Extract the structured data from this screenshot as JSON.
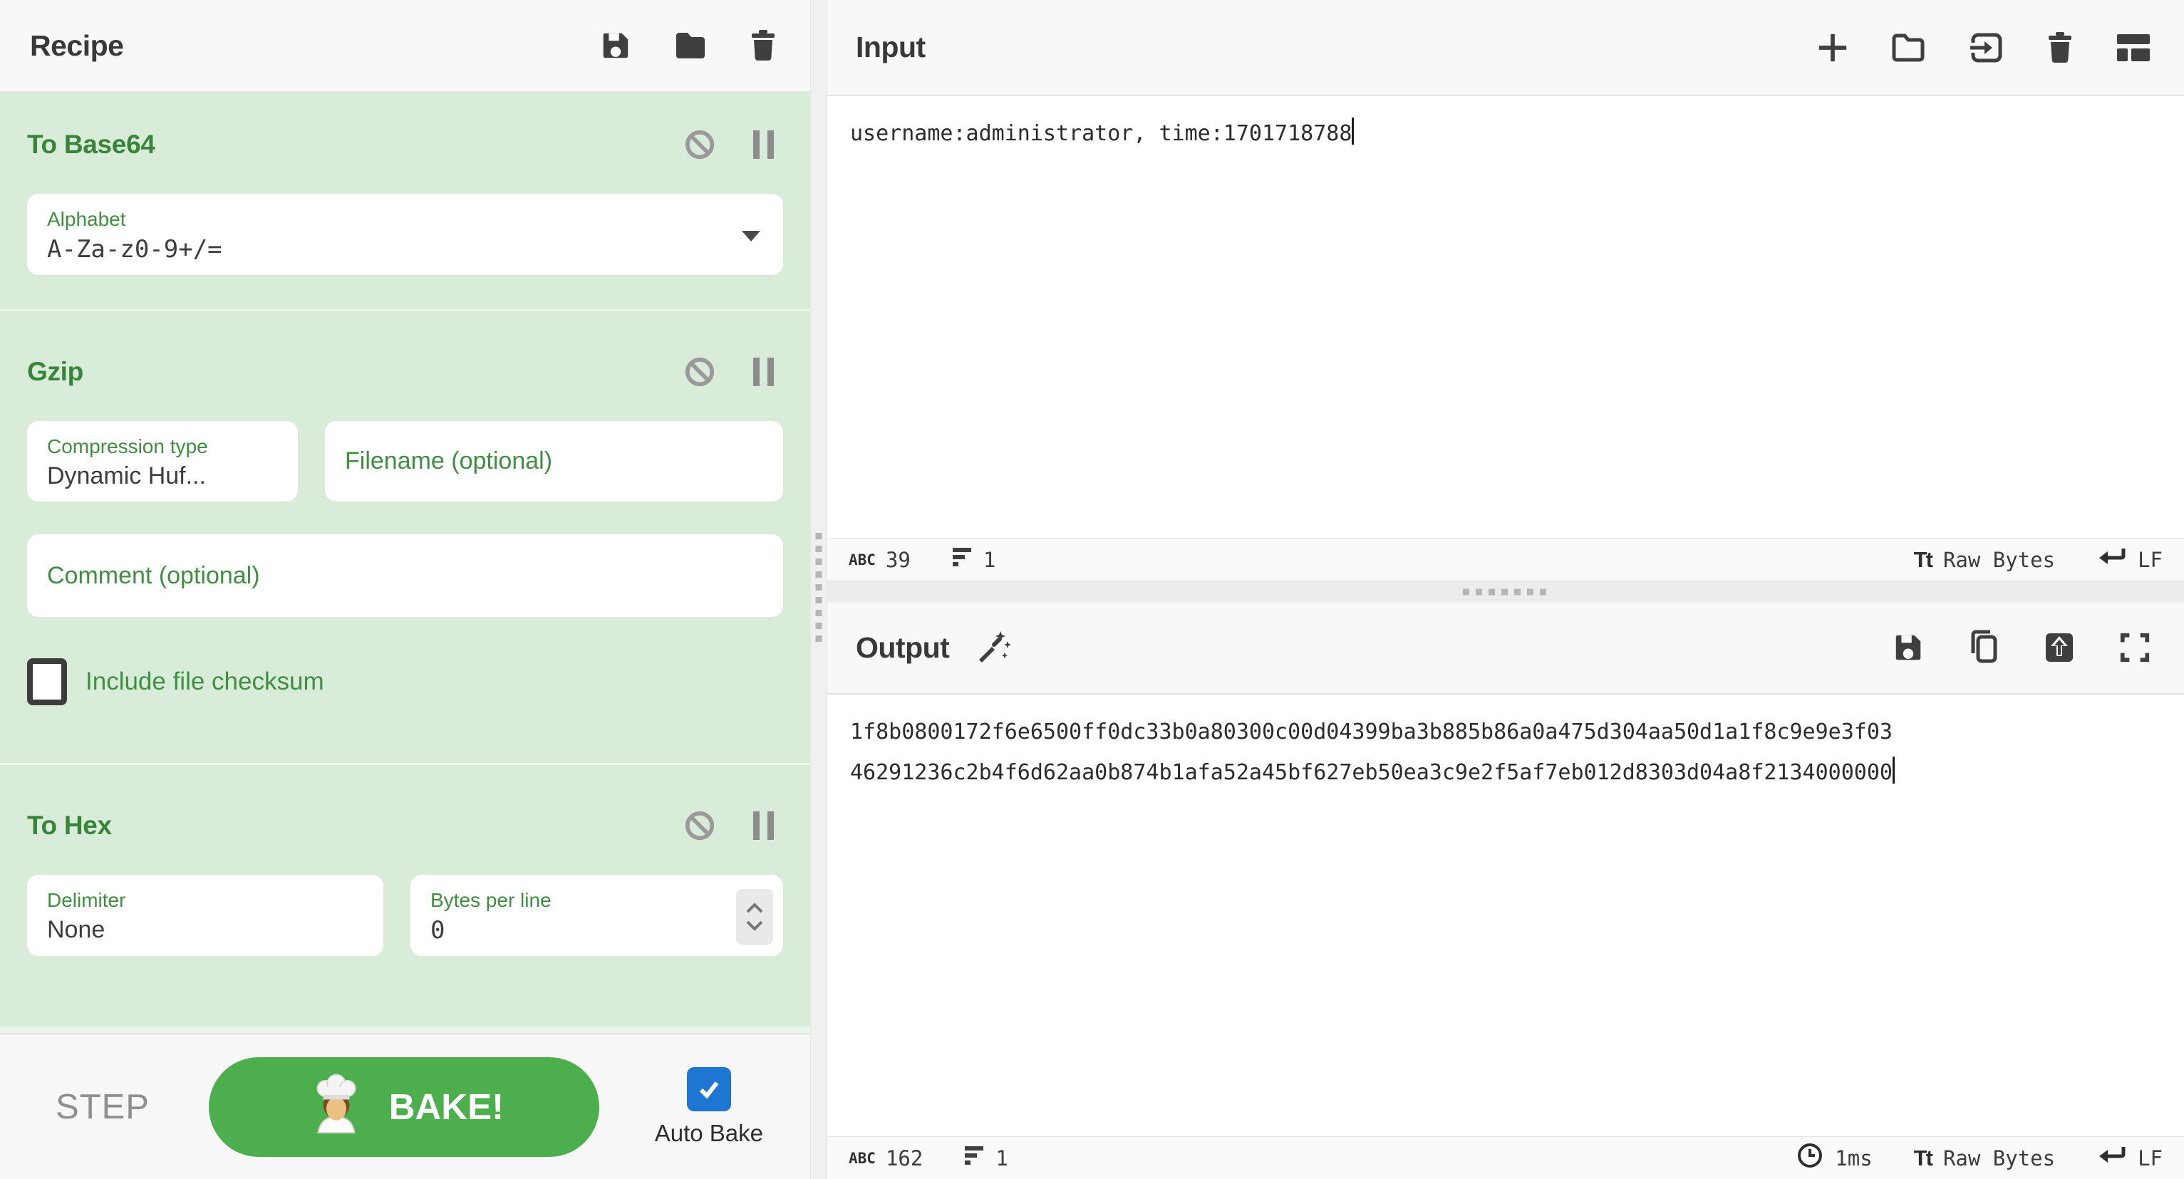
{
  "recipe": {
    "title": "Recipe",
    "operations": [
      {
        "name": "To Base64",
        "args": {
          "alphabet_label": "Alphabet",
          "alphabet_value": "A-Za-z0-9+/="
        }
      },
      {
        "name": "Gzip",
        "args": {
          "compression_label": "Compression type",
          "compression_value": "Dynamic Huf...",
          "filename_placeholder": "Filename (optional)",
          "comment_placeholder": "Comment (optional)",
          "checksum_label": "Include file checksum",
          "checksum_checked": false
        }
      },
      {
        "name": "To Hex",
        "args": {
          "delimiter_label": "Delimiter",
          "delimiter_value": "None",
          "bytes_label": "Bytes per line",
          "bytes_value": "0"
        }
      }
    ],
    "controls": {
      "step_label": "STEP",
      "bake_label": "BAKE!",
      "auto_bake_label": "Auto Bake",
      "auto_bake_checked": true
    }
  },
  "input": {
    "title": "Input",
    "text": "username:administrator, time:1701718788",
    "status": {
      "char_icon": "ABC",
      "char_count": "39",
      "line_count": "1",
      "encoding_icon": "Tt",
      "encoding_label": "Raw Bytes",
      "eol_label": "LF"
    }
  },
  "output": {
    "title": "Output",
    "lines": [
      "1f8b0800172f6e6500ff0dc33b0a80300c00d04399ba3b885b86a0a475d304aa50d1a1f8c9e9e3f03",
      "46291236c2b4f6d62aa0b874b1afa52a45bf627eb50ea3c9e2f5af7eb012d8303d04a8f2134000000"
    ],
    "status": {
      "char_icon": "ABC",
      "char_count": "162",
      "line_count": "1",
      "bake_time": "1ms",
      "encoding_icon": "Tt",
      "encoding_label": "Raw Bytes",
      "eol_label": "LF"
    }
  },
  "colors": {
    "accent_green": "#3f8f41",
    "operation_bg": "#d9ecd9",
    "bake_green": "#4cae4c",
    "autobake_blue": "#1e76d2"
  }
}
